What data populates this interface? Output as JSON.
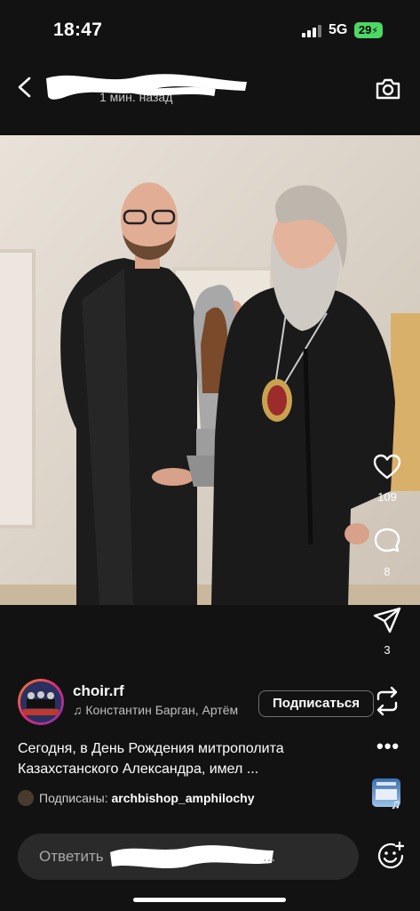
{
  "status_bar": {
    "time": "18:47",
    "network": "5G",
    "battery": "29"
  },
  "header": {
    "time_ago": "1 мин. назад"
  },
  "actions": {
    "likes": "109",
    "comments": "8",
    "shares": "3"
  },
  "post": {
    "author": "choir.rf",
    "music": "Константин Барган, Артём",
    "follow_label": "Подписаться",
    "caption_line1": "Сегодня, в День Рождения митрополита",
    "caption_line2": "Казахстанского Александра, имел ...",
    "more_label": "•••",
    "followed_prefix": "Подписаны:",
    "followed_user": "archbishop_amphilochy"
  },
  "reply": {
    "placeholder_prefix": "Ответить",
    "placeholder_suffix": "..."
  },
  "colors": {
    "background": "#121212",
    "battery": "#4cd964",
    "reply_bg": "#2a2a2a"
  }
}
